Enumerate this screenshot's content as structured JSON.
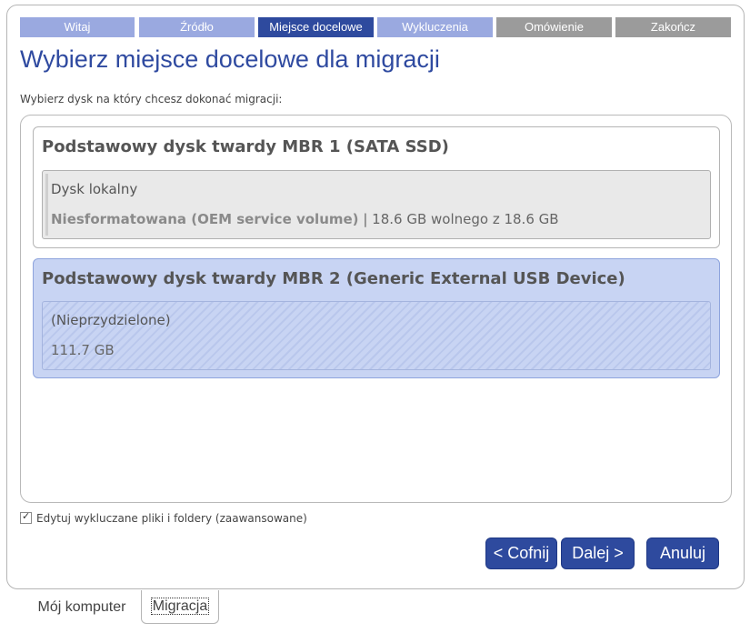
{
  "wizard": {
    "steps": [
      "Witaj",
      "Źródło",
      "Miejsce docelowe",
      "Wykluczenia",
      "Omówienie",
      "Zakończ"
    ],
    "title": "Wybierz miejsce docelowe dla migracji",
    "subtitle": "Wybierz dysk na który chcesz dokonać migracji:"
  },
  "disks": [
    {
      "title": "Podstawowy dysk twardy MBR 1 (SATA SSD)",
      "partition_name": "Dysk lokalny",
      "partition_label": "Niesformatowana (OEM service volume)",
      "separator": "|",
      "partition_free": "18.6 GB wolnego z 18.6 GB"
    },
    {
      "title": "Podstawowy dysk twardy MBR 2 (Generic External USB Device)",
      "partition_name": "(Nieprzydzielone)",
      "partition_size": "111.7 GB"
    }
  ],
  "options": {
    "edit_exclusions_label": "Edytuj wykluczane pliki i foldery (zaawansowane)",
    "checkmark": "✓"
  },
  "buttons": {
    "back": "< Cofnij",
    "next": "Dalej >",
    "cancel": "Anuluj"
  },
  "bottom_tabs": [
    "Mój komputer",
    "Migracja"
  ],
  "colors": {
    "accent": "#2e4a9e",
    "step_done": "#9aa9e0",
    "step_todo": "#9b9b9b",
    "selected_disk": "#c8d4f3"
  }
}
